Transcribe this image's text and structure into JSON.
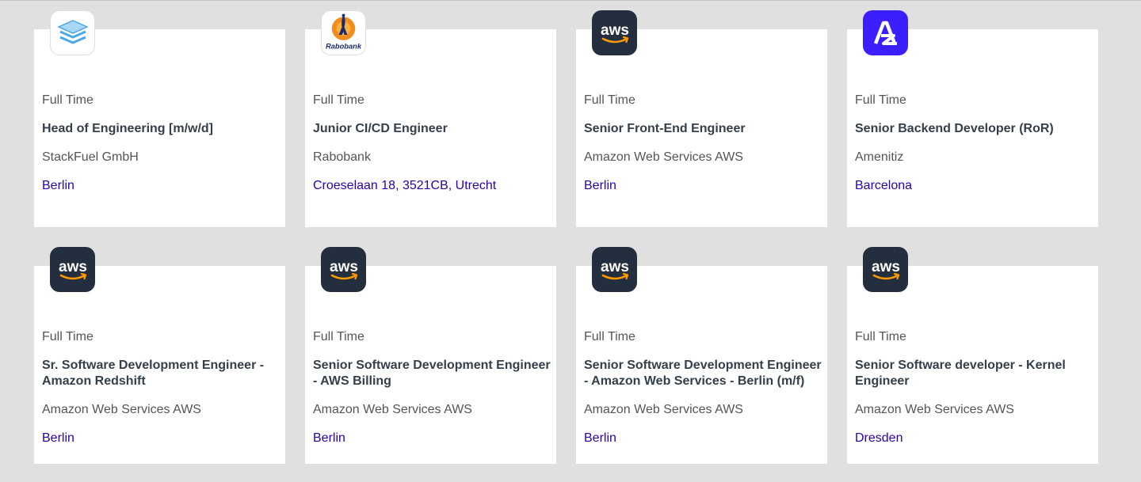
{
  "jobs": [
    {
      "type": "Full Time",
      "title": "Head of Engineering [m/w/d]",
      "company": "StackFuel GmbH",
      "location": "Berlin",
      "logo": "stackfuel-layers-icon"
    },
    {
      "type": "Full Time",
      "title": "Junior CI/CD Engineer",
      "company": "Rabobank",
      "location": "Croeselaan 18, 3521CB, Utrecht",
      "logo": "rabobank-logo",
      "logo_text": "Rabobank"
    },
    {
      "type": "Full Time",
      "title": "Senior Front-End Engineer",
      "company": "Amazon Web Services AWS",
      "location": "Berlin",
      "logo": "aws-logo",
      "logo_text": "aws"
    },
    {
      "type": "Full Time",
      "title": "Senior Backend Developer (RoR)",
      "company": "Amenitiz",
      "location": "Barcelona",
      "logo": "amenitiz-logo"
    },
    {
      "type": "Full Time",
      "title": "Sr. Software Development Engineer - Amazon Redshift",
      "company": "Amazon Web Services AWS",
      "location": "Berlin",
      "logo": "aws-logo",
      "logo_text": "aws"
    },
    {
      "type": "Full Time",
      "title": "Senior Software Development Engineer - AWS Billing",
      "company": "Amazon Web Services AWS",
      "location": "Berlin",
      "logo": "aws-logo",
      "logo_text": "aws"
    },
    {
      "type": "Full Time",
      "title": "Senior Software Development Engineer - Amazon Web Services - Berlin (m/f)",
      "company": "Amazon Web Services AWS",
      "location": "Berlin",
      "logo": "aws-logo",
      "logo_text": "aws"
    },
    {
      "type": "Full Time",
      "title": "Senior Software developer - Kernel Engineer",
      "company": "Amazon Web Services AWS",
      "location": "Dresden",
      "logo": "aws-logo",
      "logo_text": "aws"
    }
  ],
  "colors": {
    "background": "#e0e0e0",
    "card": "#ffffff",
    "title": "#333f4a",
    "location": "#2a00b0",
    "aws_dark": "#232f3e",
    "aws_orange": "#ff9900",
    "amenitiz": "#3b1fff"
  }
}
